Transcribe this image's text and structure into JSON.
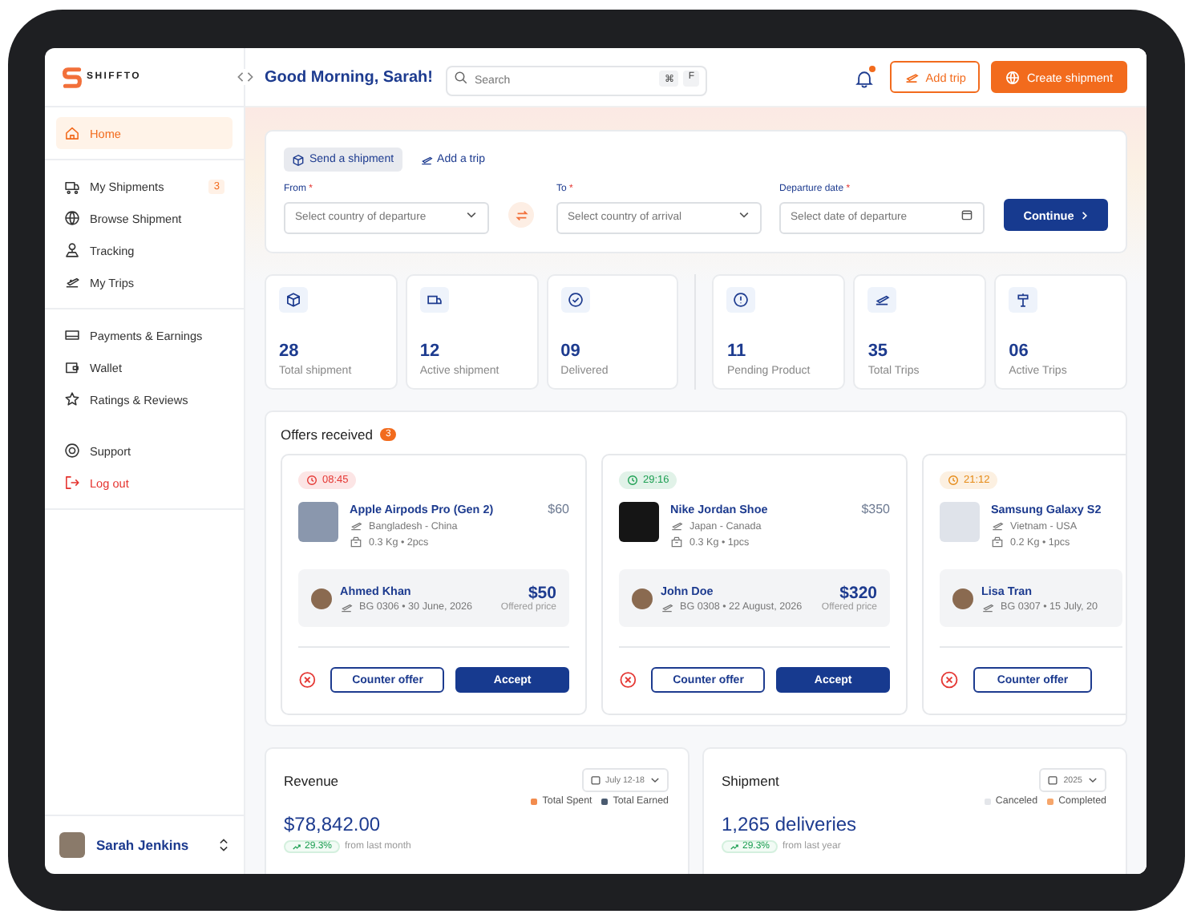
{
  "app": {
    "logo_text": "SHIFFTO"
  },
  "sidebar": {
    "groups": [
      [
        {
          "label": "Home",
          "selected": true,
          "kind": "nav"
        }
      ],
      [
        {
          "label": "My Shipments",
          "selected": false,
          "kind": "nav",
          "badge": "3"
        },
        {
          "label": "Browse Shipment",
          "selected": false,
          "kind": "nav"
        },
        {
          "label": "Tracking",
          "selected": false,
          "kind": "nav"
        },
        {
          "label": "My Trips",
          "selected": false,
          "kind": "nav"
        }
      ],
      [
        {
          "label": "Payments & Earnings",
          "selected": false,
          "kind": "nav"
        },
        {
          "label": "Wallet",
          "selected": false,
          "kind": "nav"
        },
        {
          "label": "Ratings & Reviews",
          "selected": false,
          "kind": "nav"
        }
      ],
      [
        {
          "label": "Support",
          "selected": false,
          "kind": "nav"
        },
        {
          "label": "Log out",
          "selected": false,
          "kind": "danger"
        }
      ]
    ],
    "user": {
      "name": "Sarah Jenkins"
    }
  },
  "header": {
    "greeting": "Good Morning, Sarah!",
    "search": {
      "placeholder": "Search",
      "keys": [
        "⌘",
        "F"
      ]
    },
    "notification_unread": true,
    "buttons": [
      {
        "label": "Add trip",
        "kind": "outline"
      },
      {
        "label": "Create shipment",
        "kind": "primary"
      }
    ]
  },
  "booking": {
    "tabs": [
      {
        "label": "Send a shipment",
        "selected": true
      },
      {
        "label": "Add a trip",
        "selected": false
      }
    ],
    "fields": [
      {
        "label": "From",
        "required_mark": "*",
        "placeholder": "Select country of departure",
        "kind": "select"
      },
      {
        "label": "To",
        "required_mark": "*",
        "placeholder": "Select country of arrival",
        "kind": "select"
      },
      {
        "label": "Departure date",
        "required_mark": "*",
        "placeholder": "Select date of departure",
        "kind": "date"
      }
    ],
    "submit": "Continue"
  },
  "stats": [
    [
      {
        "value": "28",
        "label": "Total shipment"
      },
      {
        "value": "12",
        "label": "Active shipment"
      },
      {
        "value": "09",
        "label": "Delivered"
      }
    ],
    [
      {
        "value": "11",
        "label": "Pending Product"
      },
      {
        "value": "35",
        "label": "Total Trips"
      },
      {
        "value": "06",
        "label": "Active Trips"
      }
    ]
  ],
  "offers": {
    "title": "Offers received",
    "count": "3",
    "items": [
      {
        "timer": "08:45",
        "color": "#e53935",
        "product": "Apple Airpods Pro (Gen 2)",
        "price": "$60",
        "route": "Bangladesh - China",
        "details": "0.3 Kg • 2pcs",
        "traveler": "Ahmed Khan",
        "trip": "BG 0306 • 30 June, 2026",
        "offer": "$50",
        "offer_label": "Offered price",
        "actions": [
          "Counter offer",
          "Accept"
        ]
      },
      {
        "timer": "29:16",
        "color": "#1a9e50",
        "product": "Nike Jordan Shoe",
        "price": "$350",
        "route": "Japan - Canada",
        "details": "0.3 Kg • 1pcs",
        "traveler": "John Doe",
        "trip": "BG 0308 • 22 August, 2026",
        "offer": "$320",
        "offer_label": "Offered price",
        "actions": [
          "Counter offer",
          "Accept"
        ]
      },
      {
        "timer": "21:12",
        "color": "#e58a16",
        "product": "Samsung Galaxy S2",
        "route": "Vietnam - USA",
        "details": "0.2 Kg • 1pcs",
        "traveler": "Lisa Tran",
        "trip": "BG 0307 • 15 July, 20",
        "actions": [
          "Counter offer"
        ]
      }
    ]
  },
  "panels": [
    {
      "title": "Revenue",
      "period": "July 12-18",
      "legend": [
        {
          "label": "Total Spent",
          "color": "#f28c4e"
        },
        {
          "label": "Total Earned",
          "color": "#4a5b70"
        }
      ],
      "total": "$78,842.00",
      "change": "29.3%",
      "change_note": "from last month"
    },
    {
      "title": "Shipment",
      "period": "2025",
      "legend": [
        {
          "label": "Canceled",
          "color": "#e4e6ea"
        },
        {
          "label": "Completed",
          "color": "#f6a66b"
        }
      ],
      "total": "1,265 deliveries",
      "change": "29.3%",
      "change_note": "from last year"
    }
  ]
}
